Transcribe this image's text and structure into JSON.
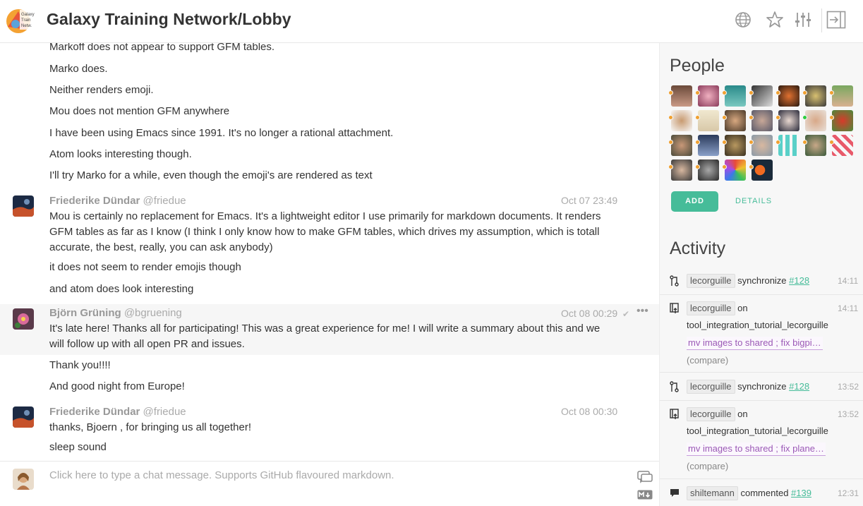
{
  "header": {
    "title": "Galaxy Training Network/Lobby",
    "logo_text": "Galaxy Training Network",
    "icons": [
      "globe-icon",
      "star-icon",
      "settings-sliders-icon",
      "collapse-panel-icon"
    ]
  },
  "chat": {
    "lines_top": [
      "Markoff does not appear to support GFM tables.",
      "Marko does.",
      "Neither renders emoji.",
      "Mou does not mention GFM anywhere",
      "I have been using Emacs since 1991. It's no longer a rational attachment.",
      "Atom looks interesting though.",
      "I'll try Marko for a while, even though the emoji's are rendered as text"
    ],
    "msg1": {
      "author": "Friederike Dündar",
      "handle": "@friedue",
      "time": "Oct 07 23:49",
      "body": "Mou is certainly no replacement for Emacs. It's a lightweight editor I use primarily for markdown documents. It renders GFM tables as far as I know (I think I only know how to make GFM tables, which drives my assumption, which is totall accurate, the best, really, you can ask anybody)",
      "line2": "it does not seem to render emojis though",
      "line3": "and atom does look interesting"
    },
    "msg2": {
      "author": "Björn Grüning",
      "handle": "@bgruening",
      "time": "Oct 08 00:29",
      "body": "It's late here! Thanks all for participating! This was a great experience for me! I will write a summary about this and we will follow up with all open PR and issues.",
      "line2": "Thank you!!!!",
      "line3": "And good night from Europe!"
    },
    "msg3": {
      "author": "Friederike Dündar",
      "handle": "@friedue",
      "time": "Oct 08 00:30",
      "body": "thanks, Bjoern , for bringing us all together!",
      "line2": "sleep sound"
    }
  },
  "composer": {
    "placeholder": "Click here to type a chat message. Supports GitHub flavoured markdown.",
    "md_label": "M↓"
  },
  "people": {
    "title": "People",
    "avatar_count": 26,
    "add_label": "ADD",
    "details_label": "DETAILS"
  },
  "activity": {
    "title": "Activity",
    "items": [
      {
        "user": "lecorguille",
        "action": "synchronize",
        "ref": "#128",
        "time": "14:11"
      },
      {
        "user": "lecorguille",
        "action": "on",
        "repo": "tool_integration_tutorial_lecorguille",
        "commit": "mv images to shared ; fix bigpi…",
        "compare": "(compare)",
        "time": "14:11"
      },
      {
        "user": "lecorguille",
        "action": "synchronize",
        "ref": "#128",
        "time": "13:52"
      },
      {
        "user": "lecorguille",
        "action": "on",
        "repo": "tool_integration_tutorial_lecorguille",
        "commit": "mv images to shared ; fix plane…",
        "compare": "(compare)",
        "time": "13:52"
      },
      {
        "user": "shiltemann",
        "action": "commented",
        "ref": "#139",
        "time": "12:31"
      }
    ]
  },
  "colors": {
    "accent": "#46bc99",
    "commit": "#9b59b6",
    "status_away": "#f0a030",
    "status_online": "#2ecc40"
  }
}
